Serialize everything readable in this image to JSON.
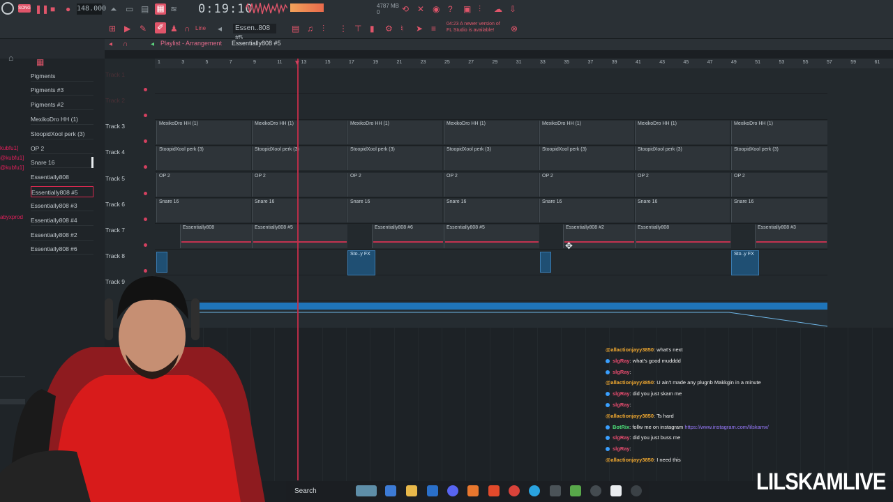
{
  "toolbar": {
    "song_label": "SONG",
    "tempo": "148.000",
    "clock": "0:19:10",
    "memory": "4787 MB",
    "memory_sub": "0",
    "pattern_name": "Essen..808 #5",
    "mode_label": "Line",
    "update_notice_line1": "04:23 A newer version of",
    "update_notice_line2": "FL Studio is available!"
  },
  "playlist": {
    "breadcrumb_root": "Playlist - Arrangement",
    "breadcrumb_pattern": "Essentially808 #5",
    "ruler": [
      "1",
      "3",
      "5",
      "7",
      "9",
      "11",
      "13",
      "15",
      "17",
      "19",
      "21",
      "23",
      "25",
      "27",
      "29",
      "31",
      "33",
      "35",
      "37",
      "39",
      "41",
      "43",
      "45",
      "47",
      "49",
      "51",
      "53",
      "55",
      "57",
      "59",
      "61"
    ],
    "tracks": [
      {
        "label": "Track 1"
      },
      {
        "label": "Track 2"
      },
      {
        "label": "Track 3"
      },
      {
        "label": "Track 4"
      },
      {
        "label": "Track 5"
      },
      {
        "label": "Track 6"
      },
      {
        "label": "Track 7"
      },
      {
        "label": "Track 8"
      },
      {
        "label": "Track 9"
      }
    ],
    "clip_names": {
      "t3": "MexikoDro HH (1)",
      "t4": "StoopidXool perk (3)",
      "t5": "OP 2",
      "t6": "Snare 16",
      "t7a": "Essentially808",
      "t7b": "Essentially808 #5",
      "t7c": "Essentially808 #6",
      "t7d": "Essentially808 #5",
      "t7e": "Essentially808 #2",
      "t7f": "Essentially808",
      "t7g": "Essentially808 #3",
      "t8": "Sto..y FX"
    }
  },
  "browser": {
    "items": [
      "Pigments",
      "Pigments #3",
      "Pigments #2",
      "MexikoDro HH (1)",
      "StoopidXool perk (3)",
      "OP 2",
      "Snare 16",
      "Essentially808",
      "Essentially808 #5",
      "Essentially808 #3",
      "Essentially808 #4",
      "Essentially808 #2",
      "Essentially808 #6"
    ],
    "selected_index": 8,
    "left_tags": [
      "kubfu1]",
      "@kubfu1]",
      "@kubfu1]",
      "abyxprod"
    ]
  },
  "chat": {
    "messages": [
      {
        "user": "@allactionjayy3850",
        "text": ": what's next",
        "color": "a"
      },
      {
        "user": "slgRay",
        "text": ": what's good mudddd",
        "color": "b"
      },
      {
        "user": "slgRay",
        "text": ":",
        "color": "b"
      },
      {
        "user": "@allactionjayy3850",
        "text": ": U ain't made any plugnb Makkgin in a minute",
        "color": "a"
      },
      {
        "user": "slgRay",
        "text": ": did you just skam me",
        "color": "b"
      },
      {
        "user": "slgRay",
        "text": ":",
        "color": "b"
      },
      {
        "user": "@allactionjayy3850",
        "text": ": Ts hard",
        "color": "a"
      },
      {
        "user": "BotRix",
        "text": ": follw me on instagram ",
        "link": "https://www.instagram.com/lilskamx/",
        "color": "c"
      },
      {
        "user": "slgRay",
        "text": ": did you just buss me",
        "color": "b"
      },
      {
        "user": "slgRay",
        "text": ":",
        "color": "b"
      },
      {
        "user": "@allactionjayy3850",
        "text": ": I need this",
        "color": "a"
      }
    ]
  },
  "taskbar": {
    "search_label": "Search"
  },
  "overlay": {
    "brand": "LILSKAMLIVE"
  },
  "colors": {
    "accent": "#e0556a",
    "playhead": "#c82e4a",
    "automation_blue": "#1f74b8",
    "clip_bg": "#2e3439"
  }
}
